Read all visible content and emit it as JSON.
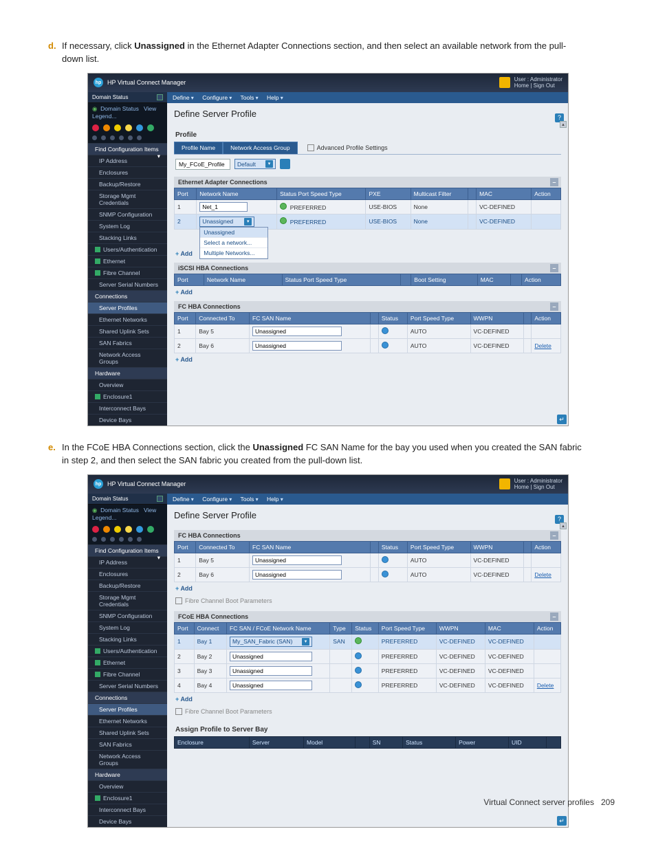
{
  "page": {
    "footer_left": "Virtual Connect server profiles",
    "footer_page": "209"
  },
  "steps": {
    "d": {
      "bullet": "d.",
      "text_before": "If necessary, click ",
      "bold1": "Unassigned",
      "text_after": " in the Ethernet Adapter Connections section, and then select an available network from the pull-down list."
    },
    "e": {
      "bullet": "e.",
      "text_before": "In the FCoE HBA Connections section, click the ",
      "bold1": "Unassigned",
      "text_after": " FC SAN Name for the bay you used when you created the SAN fabric in step 2, and then select the SAN fabric you created from the pull-down list."
    }
  },
  "app": {
    "title": "HP Virtual Connect Manager",
    "user_line1": "User : Administrator",
    "user_line2": "Home | Sign Out",
    "menu": [
      "Define",
      "Configure",
      "Tools",
      "Help"
    ],
    "page_title": "Define Server Profile",
    "help_icon": "?",
    "profile": {
      "section": "Profile",
      "tab1": "Profile Name",
      "tab2": "Network Access Group",
      "advanced": "Advanced Profile Settings",
      "name_value": "My_FCoE_Profile",
      "nag_value": "Default"
    },
    "add_label": "Add",
    "delete_label": "Delete",
    "sidebar": {
      "domain_status_hdr": "Domain Status",
      "domain_status": "Domain Status",
      "view_legend": "View Legend...",
      "find_items": "Find Configuration Items",
      "groups": {
        "conn": "Connections",
        "hw": "Hardware"
      },
      "items1": [
        "IP Address",
        "Enclosures",
        "Backup/Restore",
        "Storage Mgmt Credentials",
        "SNMP Configuration",
        "System Log",
        "Stacking Links",
        "Users/Authentication",
        "Ethernet",
        "Fibre Channel",
        "Server Serial Numbers"
      ],
      "items2": [
        "Server Profiles",
        "Ethernet Networks",
        "Shared Uplink Sets",
        "SAN Fabrics",
        "Network Access Groups"
      ],
      "items3": [
        "Overview",
        "Enclosure1",
        "Interconnect Bays",
        "Device Bays"
      ]
    },
    "eth": {
      "title": "Ethernet Adapter Connections",
      "headers": [
        "Port",
        "Network Name",
        "Status Port Speed Type",
        "PXE",
        "Multicast Filter",
        "",
        "MAC",
        "Action"
      ],
      "row1": {
        "port": "1",
        "net": "Net_1",
        "status_icon": "green",
        "speed": "PREFERRED",
        "pxe": "USE-BIOS",
        "filter": "None",
        "mac": "VC-DEFINED"
      },
      "row2": {
        "port": "2",
        "net": "Unassigned",
        "status_icon": "green",
        "speed": "PREFERRED",
        "pxe": "USE-BIOS",
        "filter": "None",
        "mac": "VC-DEFINED"
      },
      "dropdown": [
        "Unassigned",
        "Select a network...",
        "Multiple Networks..."
      ]
    },
    "iscsi": {
      "title": "iSCSI HBA Connections",
      "headers": [
        "Port",
        "Network Name",
        "Status Port Speed Type",
        "",
        "Boot Setting",
        "MAC",
        "",
        "Action"
      ]
    },
    "fc": {
      "title": "FC HBA Connections",
      "headers": [
        "Port",
        "Connected To",
        "FC SAN Name",
        "",
        "Status",
        "Port Speed Type",
        "WWPN",
        "",
        "Action"
      ],
      "rows": [
        {
          "port": "1",
          "bay": "Bay 5",
          "name": "Unassigned",
          "icon": "blue",
          "speed": "AUTO",
          "wwpn": "VC-DEFINED",
          "delete": ""
        },
        {
          "port": "2",
          "bay": "Bay 6",
          "name": "Unassigned",
          "icon": "blue",
          "speed": "AUTO",
          "wwpn": "VC-DEFINED",
          "delete": "Delete"
        }
      ]
    },
    "fc2": {
      "title": "FC HBA Connections",
      "headers": [
        "Port",
        "Connected To",
        "FC SAN Name",
        "",
        "Status",
        "Port Speed Type",
        "WWPN",
        "",
        "Action"
      ],
      "rows": [
        {
          "port": "1",
          "bay": "Bay 5",
          "name": "Unassigned",
          "icon": "blue",
          "speed": "AUTO",
          "wwpn": "VC-DEFINED",
          "delete": ""
        },
        {
          "port": "2",
          "bay": "Bay 6",
          "name": "Unassigned",
          "icon": "blue",
          "speed": "AUTO",
          "wwpn": "VC-DEFINED",
          "delete": "Delete"
        }
      ],
      "fibre_params": "Fibre Channel Boot Parameters"
    },
    "fcoe": {
      "title": "FCoE HBA Connections",
      "headers": [
        "Port",
        "Connect",
        "FC SAN / FCoE Network Name",
        "Type",
        "Status",
        "Port Speed Type",
        "WWPN",
        "MAC",
        "Action"
      ],
      "rows": [
        {
          "port": "1",
          "bay": "Bay 1",
          "name": "My_SAN_Fabric  (SAN)",
          "type": "SAN",
          "icon": "green",
          "speed": "PREFERRED",
          "wwpn": "VC-DEFINED",
          "mac": "VC-DEFINED",
          "delete": ""
        },
        {
          "port": "2",
          "bay": "Bay 2",
          "name": "Unassigned",
          "type": "",
          "icon": "blue",
          "speed": "PREFERRED",
          "wwpn": "VC-DEFINED",
          "mac": "VC-DEFINED",
          "delete": ""
        },
        {
          "port": "3",
          "bay": "Bay 3",
          "name": "Unassigned",
          "type": "",
          "icon": "blue",
          "speed": "PREFERRED",
          "wwpn": "VC-DEFINED",
          "mac": "VC-DEFINED",
          "delete": ""
        },
        {
          "port": "4",
          "bay": "Bay 4",
          "name": "Unassigned",
          "type": "",
          "icon": "blue",
          "speed": "PREFERRED",
          "wwpn": "VC-DEFINED",
          "mac": "VC-DEFINED",
          "delete": "Delete"
        }
      ],
      "fibre_params": "Fibre Channel Boot Parameters"
    },
    "assign": {
      "title": "Assign Profile to Server Bay",
      "headers": [
        "Enclosure",
        "Server",
        "Model",
        "",
        "SN",
        "Status",
        "Power",
        "UID",
        ""
      ]
    }
  }
}
